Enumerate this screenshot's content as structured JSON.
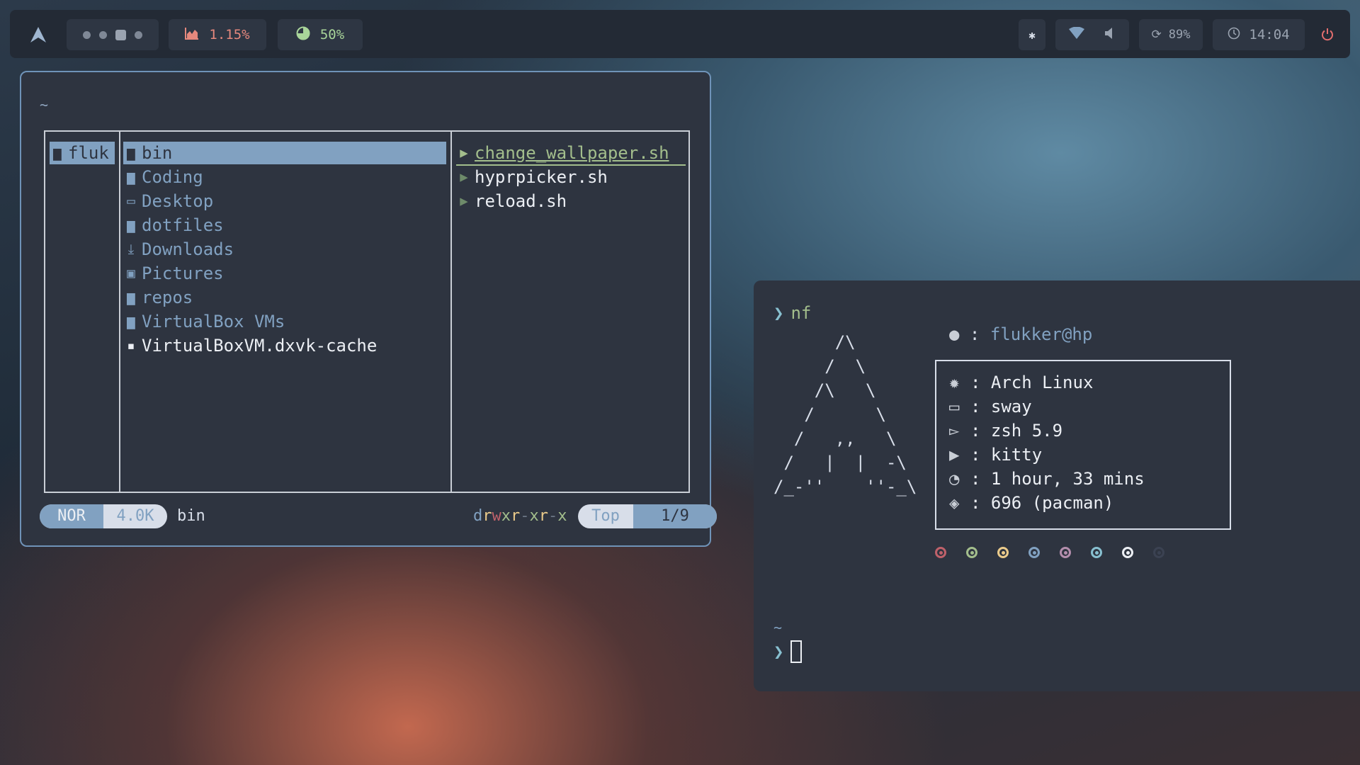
{
  "topbar": {
    "logo_icon": "arch-logo-icon",
    "workspaces": [
      "dot",
      "dot",
      "square",
      "dot"
    ],
    "cpu": "1.15%",
    "memory": "50%",
    "battery": "89%",
    "clock": "14:04"
  },
  "file_manager": {
    "path": "~",
    "parent_column": [
      {
        "name": "fluk",
        "icon": "folder-icon"
      }
    ],
    "current_column": [
      {
        "name": "bin",
        "icon": "folder-icon",
        "type": "dir",
        "selected": true
      },
      {
        "name": "Coding",
        "icon": "folder-icon",
        "type": "dir"
      },
      {
        "name": "Desktop",
        "icon": "desktop-icon",
        "type": "dir"
      },
      {
        "name": "dotfiles",
        "icon": "folder-icon",
        "type": "dir"
      },
      {
        "name": "Downloads",
        "icon": "download-icon",
        "type": "dir"
      },
      {
        "name": "Pictures",
        "icon": "picture-icon",
        "type": "dir"
      },
      {
        "name": "repos",
        "icon": "folder-icon",
        "type": "dir"
      },
      {
        "name": "VirtualBox VMs",
        "icon": "folder-icon",
        "type": "dir"
      },
      {
        "name": "VirtualBoxVM.dxvk-cache",
        "icon": "file-icon",
        "type": "file"
      }
    ],
    "preview_column": [
      {
        "name": "change_wallpaper.sh",
        "icon": "terminal-icon",
        "hovered": true
      },
      {
        "name": "hyprpicker.sh",
        "icon": "terminal-icon"
      },
      {
        "name": "reload.sh",
        "icon": "terminal-icon"
      }
    ],
    "status": {
      "mode": "NOR",
      "size": "4.0K",
      "current_name": "bin",
      "permissions": [
        "d",
        "r",
        "w",
        "x",
        "r",
        "-",
        "x",
        "r",
        "-",
        "x"
      ],
      "position_label": "Top",
      "position": "1/9"
    }
  },
  "terminal": {
    "prompt1_command": "nf",
    "ascii_art": "      /\\\n     /  \\\n    /\\   \\\n   /      \\\n  /   ,,   \\\n /   |  |  -\\\n/_-''    ''-_\\",
    "user": "flukker@hp",
    "info": [
      {
        "icon": "gear-icon",
        "value": "Arch Linux"
      },
      {
        "icon": "window-icon",
        "value": "sway"
      },
      {
        "icon": "shell-icon",
        "value": "zsh 5.9"
      },
      {
        "icon": "terminal-icon",
        "value": "kitty"
      },
      {
        "icon": "uptime-icon",
        "value": "1 hour, 33 mins"
      },
      {
        "icon": "package-icon",
        "value": "696 (pacman)"
      }
    ],
    "palette": [
      "#bf616a",
      "#a3be8c",
      "#ebcb8b",
      "#81a1c1",
      "#b48ead",
      "#88c0d0",
      "#eceff4",
      "#3b4252"
    ],
    "cwd": "~"
  }
}
